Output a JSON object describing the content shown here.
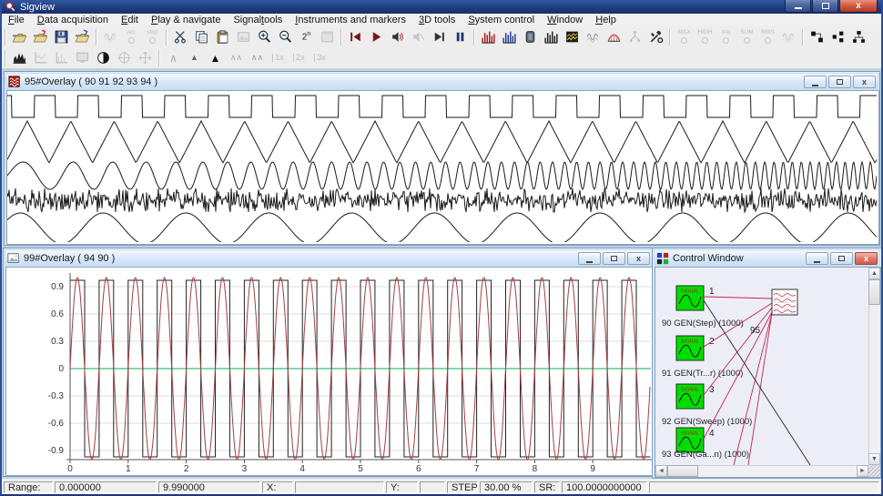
{
  "window": {
    "title": "Sigview"
  },
  "menu": {
    "items": [
      {
        "label": "File",
        "accel": 0
      },
      {
        "label": "Data acquisition",
        "accel": 0
      },
      {
        "label": "Edit",
        "accel": 0
      },
      {
        "label": "Play & navigate",
        "accel": 0
      },
      {
        "label": "Signal tools",
        "accel": 7
      },
      {
        "label": "Instruments and markers",
        "accel": 0
      },
      {
        "label": "3D tools",
        "accel": 0
      },
      {
        "label": "System control",
        "accel": 0
      },
      {
        "label": "Window",
        "accel": 0
      },
      {
        "label": "Help",
        "accel": 0
      }
    ]
  },
  "toolbars": {
    "row1": [
      {
        "items": [
          {
            "name": "open-file",
            "t": "folder"
          },
          {
            "name": "open-signal-file",
            "t": "folder",
            "accent": "#c22222"
          },
          {
            "name": "save",
            "t": "floppy"
          },
          {
            "name": "open-workspace",
            "t": "folder",
            "accent": "#2255cc"
          }
        ]
      },
      {
        "items": [
          {
            "name": "data-acquisition",
            "t": "wavegray",
            "disabled": true
          },
          {
            "name": "record",
            "t": "mini",
            "label": "rec",
            "ring": true,
            "disabled": true
          },
          {
            "name": "stop",
            "t": "mini",
            "label": "stop",
            "ring": true,
            "disabled": true
          }
        ]
      },
      {
        "items": [
          {
            "name": "cut",
            "t": "scissors"
          },
          {
            "name": "copy",
            "t": "copy"
          },
          {
            "name": "paste",
            "t": "paste"
          },
          {
            "name": "copy-image",
            "t": "imagegray",
            "disabled": true
          },
          {
            "name": "zoom-in",
            "t": "zoom",
            "sign": "+"
          },
          {
            "name": "zoom-out",
            "t": "zoom",
            "sign": "-"
          },
          {
            "name": "next-power-2",
            "t": "pow2",
            "label": "2"
          },
          {
            "name": "window-props",
            "t": "graywin",
            "disabled": true
          }
        ]
      },
      {
        "items": [
          {
            "name": "play-from-start",
            "t": "skipstart"
          },
          {
            "name": "play",
            "t": "play"
          },
          {
            "name": "play-sound",
            "t": "speaker"
          },
          {
            "name": "mute",
            "t": "speakermute",
            "disabled": true
          },
          {
            "name": "play-to-end",
            "t": "skipend"
          },
          {
            "name": "pause",
            "t": "pause"
          }
        ]
      },
      {
        "items": [
          {
            "name": "fft",
            "t": "comb",
            "c": "#b02020"
          },
          {
            "name": "spectrogram",
            "t": "comb",
            "c": "#2a3f8f"
          },
          {
            "name": "filter",
            "t": "battery"
          },
          {
            "name": "fft-settings",
            "t": "comb",
            "c": "#222222"
          },
          {
            "name": "waterfall",
            "t": "waterfall"
          },
          {
            "name": "smoothing",
            "t": "wavegray"
          },
          {
            "name": "band-analysis",
            "t": "arch"
          },
          {
            "name": "signal-tree",
            "t": "branch",
            "disabled": true
          },
          {
            "name": "tools",
            "t": "tools"
          }
        ]
      },
      {
        "items": [
          {
            "name": "marker-max",
            "t": "mini",
            "label": "MAX",
            "ring": true,
            "disabled": true
          },
          {
            "name": "marker-high",
            "t": "mini",
            "label": "HIGH",
            "ring": true,
            "disabled": true
          },
          {
            "name": "marker-ltb",
            "t": "mini",
            "label": "lt-b",
            "ring": true,
            "disabled": true
          },
          {
            "name": "marker-sum",
            "t": "mini",
            "label": "SUM",
            "ring": true,
            "disabled": true
          },
          {
            "name": "marker-rms",
            "t": "mini",
            "label": "RMS",
            "ring": true,
            "disabled": true
          },
          {
            "name": "marker-envelope",
            "t": "wavegray",
            "disabled": true
          }
        ]
      },
      {
        "items": [
          {
            "name": "new-control-window",
            "t": "diag1"
          },
          {
            "name": "block-diagram",
            "t": "diag2"
          },
          {
            "name": "workspace-tree",
            "t": "diag3"
          }
        ]
      }
    ],
    "row2": [
      {
        "items": [
          {
            "name": "filled-spectrum",
            "t": "specfill"
          },
          {
            "name": "axes-style",
            "t": "axes",
            "disabled": true
          },
          {
            "name": "bar-style",
            "t": "axes2",
            "disabled": true
          },
          {
            "name": "full-screen",
            "t": "monitor",
            "disabled": true
          },
          {
            "name": "invert-colors",
            "t": "halfmoon"
          },
          {
            "name": "crosshair",
            "t": "crosshair",
            "disabled": true
          },
          {
            "name": "pan-mode",
            "t": "movearrows",
            "disabled": true
          }
        ]
      },
      {
        "items": [
          {
            "name": "peak-detect-1",
            "t": "peak",
            "label": "∧",
            "c": "#aaaaaa"
          },
          {
            "name": "peak-detect-2",
            "t": "peak",
            "label": "▲",
            "c": "#666666",
            "small": true
          },
          {
            "name": "peak-detect-3",
            "t": "peak",
            "label": "▲",
            "c": "#111111"
          },
          {
            "name": "peak-detect-4",
            "t": "peak",
            "label": "∧∧",
            "c": "#aaaaaa",
            "small": true
          },
          {
            "name": "peak-detect-5",
            "t": "peak",
            "label": "∧∧",
            "c": "#999999",
            "small": true
          },
          {
            "name": "zoom-1x",
            "t": "mini",
            "label": "1x",
            "bar": true,
            "disabled": true
          },
          {
            "name": "zoom-2x",
            "t": "mini",
            "label": "2x",
            "bar": true,
            "disabled": true
          },
          {
            "name": "zoom-3x",
            "t": "mini",
            "label": "3x",
            "bar": true,
            "disabled": true
          }
        ]
      }
    ]
  },
  "windows": {
    "overlay95": {
      "title": "95#Overlay ( 90 91 92 93 94 )"
    },
    "overlay99": {
      "title": "99#Overlay ( 94 90 )"
    },
    "control": {
      "title": "Control Window",
      "nodes": [
        {
          "num": "1",
          "label": "90 GEN(Step) (1000)"
        },
        {
          "num": "2",
          "label": "91 GEN(Tr...r) (1000)"
        },
        {
          "num": "3",
          "label": "92 GEN(Sweep) (1000)"
        },
        {
          "num": "4",
          "label": "93 GEN(Ga...n) (1000)"
        }
      ],
      "block_text": "SIGNAL",
      "output": {
        "label": "95"
      },
      "colors": {
        "block_green": "#00dd00",
        "link_red": "#c02848",
        "link_black": "#222222"
      }
    }
  },
  "status": {
    "fields": [
      {
        "name": "range-label",
        "text": "Range:"
      },
      {
        "name": "range-start",
        "text": "0.000000"
      },
      {
        "name": "range-end",
        "text": "9.990000"
      },
      {
        "name": "x-label",
        "text": "X:"
      },
      {
        "name": "x-value",
        "text": ""
      },
      {
        "name": "y-label",
        "text": "Y:"
      },
      {
        "name": "y-value",
        "text": ""
      },
      {
        "name": "step-label",
        "text": "STEP"
      },
      {
        "name": "step-value",
        "text": "30.00 %"
      },
      {
        "name": "sr-label",
        "text": "SR:"
      },
      {
        "name": "sr-value",
        "text": "100.0000000000"
      },
      {
        "name": "status-extra",
        "text": ""
      }
    ]
  },
  "chart_data": [
    {
      "type": "line",
      "window": "95#Overlay ( 90 91 92 93 94 )",
      "x_range": [
        0,
        9.99
      ],
      "sample_rate": 100,
      "samples": 1000,
      "axes_visible": false,
      "line_color": "#1a1a1a",
      "series": [
        {
          "name": "90",
          "kind": "square",
          "frequency_hz": 2
        },
        {
          "name": "91",
          "kind": "triangle",
          "frequency_hz": 2
        },
        {
          "name": "92",
          "kind": "sweep",
          "f_start_hz": 1.3,
          "f_end_hz": 10.5
        },
        {
          "name": "93",
          "kind": "gaussian-noise"
        },
        {
          "name": "94",
          "kind": "sine",
          "frequency_hz": 1.05
        }
      ]
    },
    {
      "type": "line",
      "window": "99#Overlay ( 94 90 )",
      "x_ticks": [
        0,
        1,
        2,
        3,
        4,
        5,
        6,
        7,
        8,
        9
      ],
      "y_ticks": [
        0.9,
        0.6,
        0.3,
        0,
        -0.3,
        -0.6,
        -0.9
      ],
      "x_range": [
        0,
        9.99
      ],
      "y_range": [
        -1,
        1
      ],
      "grid": "horizontal",
      "zero_line_color": "#00b050",
      "series": [
        {
          "name": "90",
          "kind": "square",
          "frequency_hz": 2,
          "amplitude": 0.97,
          "color": "#222222"
        },
        {
          "name": "94",
          "kind": "sine",
          "frequency_hz": 2,
          "amplitude": 1.0,
          "color": "#a04040"
        }
      ]
    }
  ]
}
